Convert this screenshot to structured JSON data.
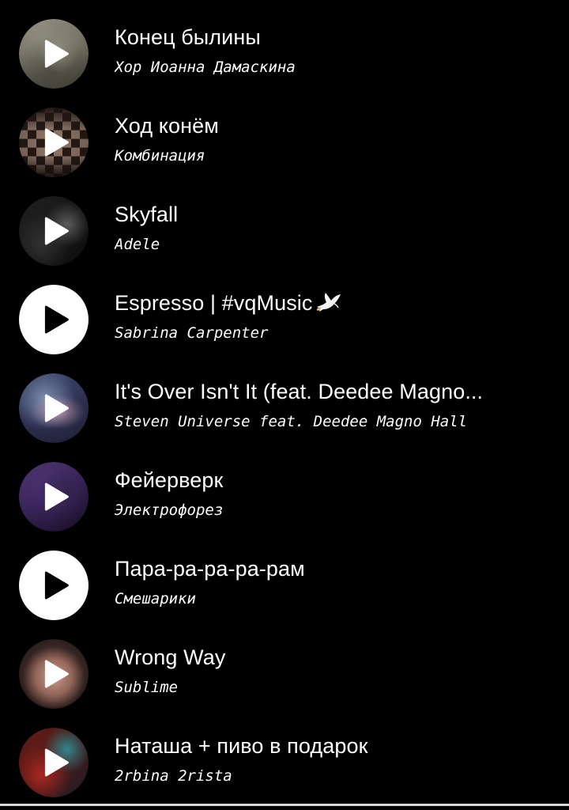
{
  "colors": {
    "background": "#000000",
    "text": "#ffffff",
    "play_button_plain": "#ffffff"
  },
  "tracks": [
    {
      "title": "Конец былины",
      "artist": "Хор Иоанна Дамаскина",
      "cover": "photo-cover",
      "title_icon": null
    },
    {
      "title": "Ход конём",
      "artist": "Комбинация",
      "cover": "chessboard-cover",
      "title_icon": null
    },
    {
      "title": "Skyfall",
      "artist": "Adele",
      "cover": "dark-cover",
      "title_icon": null
    },
    {
      "title": "Espresso | #vqMusic",
      "artist": "Sabrina Carpenter",
      "cover": "plain-white",
      "title_icon": "dove-icon"
    },
    {
      "title": "It's Over Isn't It (feat. Deedee Magno...",
      "artist": "Steven Universe feat. Deedee Magno Hall",
      "cover": "cartoon-cover",
      "title_icon": null
    },
    {
      "title": "Фейерверк",
      "artist": "Электрофорез",
      "cover": "purple-cover",
      "title_icon": null
    },
    {
      "title": "Пара-ра-ра-ра-рам",
      "artist": "Смешарики",
      "cover": "plain-white",
      "title_icon": null
    },
    {
      "title": "Wrong Way",
      "artist": "Sublime",
      "cover": "tattoo-cover",
      "title_icon": null
    },
    {
      "title": "Наташа + пиво в подарок",
      "artist": "2rbina 2rista",
      "cover": "red-poster-cover",
      "title_icon": null
    }
  ]
}
